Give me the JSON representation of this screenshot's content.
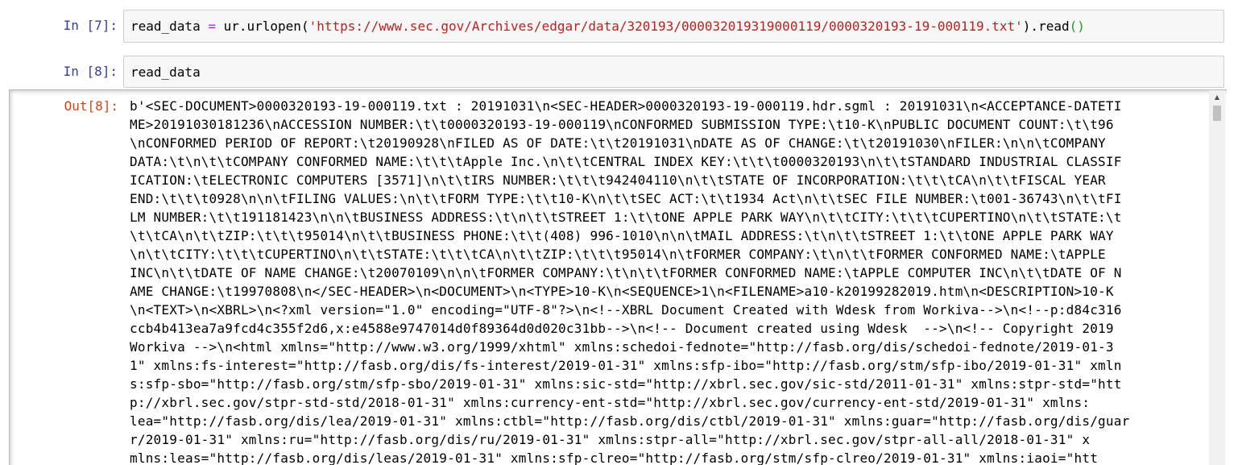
{
  "cells": [
    {
      "prompt": "In [7]:",
      "code": {
        "var": "read_data",
        "op": " = ",
        "call": "ur.urlopen(",
        "url": "'https://www.sec.gov/Archives/edgar/data/320193/000032019319000119/0000320193-19-000119.txt'",
        "close": ").read",
        "parens": "()"
      }
    },
    {
      "prompt": "In [8]:",
      "code_text": "read_data"
    }
  ],
  "output": {
    "prompt": "Out[8]:",
    "lines": [
      "b'<SEC-DOCUMENT>0000320193-19-000119.txt : 20191031\\n<SEC-HEADER>0000320193-19-000119.hdr.sgml : 20191031\\n<ACCEPTANCE-DATETI",
      "ME>20191030181236\\nACCESSION NUMBER:\\t\\t0000320193-19-000119\\nCONFORMED SUBMISSION TYPE:\\t10-K\\nPUBLIC DOCUMENT COUNT:\\t\\t96",
      "\\nCONFORMED PERIOD OF REPORT:\\t20190928\\nFILED AS OF DATE:\\t\\t20191031\\nDATE AS OF CHANGE:\\t\\t20191030\\nFILER:\\n\\n\\tCOMPANY",
      "DATA:\\t\\n\\t\\tCOMPANY CONFORMED NAME:\\t\\t\\tApple Inc.\\n\\t\\tCENTRAL INDEX KEY:\\t\\t\\t0000320193\\n\\t\\tSTANDARD INDUSTRIAL CLASSIF",
      "ICATION:\\tELECTRONIC COMPUTERS [3571]\\n\\t\\tIRS NUMBER:\\t\\t\\t942404110\\n\\t\\tSTATE OF INCORPORATION:\\t\\t\\tCA\\n\\t\\tFISCAL YEAR",
      "END:\\t\\t\\t0928\\n\\n\\tFILING VALUES:\\n\\t\\tFORM TYPE:\\t\\t10-K\\n\\t\\tSEC ACT:\\t\\t1934 Act\\n\\t\\tSEC FILE NUMBER:\\t001-36743\\n\\t\\tFI",
      "LM NUMBER:\\t\\t191181423\\n\\n\\tBUSINESS ADDRESS:\\t\\n\\t\\tSTREET 1:\\t\\tONE APPLE PARK WAY\\n\\t\\tCITY:\\t\\t\\tCUPERTINO\\n\\t\\tSTATE:\\t",
      "\\t\\tCA\\n\\t\\tZIP:\\t\\t\\t95014\\n\\t\\tBUSINESS PHONE:\\t\\t(408) 996-1010\\n\\n\\tMAIL ADDRESS:\\t\\n\\t\\tSTREET 1:\\t\\tONE APPLE PARK WAY",
      "\\n\\t\\tCITY:\\t\\t\\tCUPERTINO\\n\\t\\tSTATE:\\t\\t\\tCA\\n\\t\\tZIP:\\t\\t\\t95014\\n\\tFORMER COMPANY:\\t\\n\\t\\tFORMER CONFORMED NAME:\\tAPPLE",
      "INC\\n\\t\\tDATE OF NAME CHANGE:\\t20070109\\n\\n\\tFORMER COMPANY:\\t\\n\\t\\tFORMER CONFORMED NAME:\\tAPPLE COMPUTER INC\\n\\t\\tDATE OF N",
      "AME CHANGE:\\t19970808\\n</SEC-HEADER>\\n<DOCUMENT>\\n<TYPE>10-K\\n<SEQUENCE>1\\n<FILENAME>a10-k20199282019.htm\\n<DESCRIPTION>10-K",
      "\\n<TEXT>\\n<XBRL>\\n<?xml version=\"1.0\" encoding=\"UTF-8\"?>\\n<!--XBRL Document Created with Wdesk from Workiva-->\\n<!--p:d84c316",
      "ccb4b413ea7a9fcd4c355f2d6,x:e4588e9747014d0f89364d0d020c31bb-->\\n<!-- Document created using Wdesk  -->\\n<!-- Copyright 2019",
      "Workiva -->\\n<html xmlns=\"http://www.w3.org/1999/xhtml\" xmlns:schedoi-fednote=\"http://fasb.org/dis/schedoi-fednote/2019-01-3",
      "1\" xmlns:fs-interest=\"http://fasb.org/dis/fs-interest/2019-01-31\" xmlns:sfp-ibo=\"http://fasb.org/stm/sfp-ibo/2019-01-31\" xmln",
      "s:sfp-sbo=\"http://fasb.org/stm/sfp-sbo/2019-01-31\" xmlns:sic-std=\"http://xbrl.sec.gov/sic-std/2011-01-31\" xmlns:stpr-std=\"htt",
      "p://xbrl.sec.gov/stpr-std-std/2018-01-31\" xmlns:currency-ent-std=\"http://xbrl.sec.gov/currency-ent-std/2019-01-31\" xmlns:",
      "lea=\"http://fasb.org/dis/lea/2019-01-31\" xmlns:ctbl=\"http://fasb.org/dis/ctbl/2019-01-31\" xmlns:guar=\"http://fasb.org/dis/guar",
      "r/2019-01-31\" xmlns:ru=\"http://fasb.org/dis/ru/2019-01-31\" xmlns:stpr-all=\"http://xbrl.sec.gov/stpr-all-all/2018-01-31\" x",
      "mlns:leas=\"http://fasb.org/dis/leas/2019-01-31\" xmlns:sfp-clreo=\"http://fasb.org/stm/sfp-clreo/2019-01-31\" xmlns:iaoi=\"htt"
    ]
  },
  "scrollbar": {
    "up_arrow_icon": "triangle-up"
  },
  "colors": {
    "in_prompt": "#303f9f",
    "out_prompt": "#d84315",
    "string": "#ba2121",
    "operator": "#aa22ff",
    "cell_bg": "#f7f7f7"
  }
}
